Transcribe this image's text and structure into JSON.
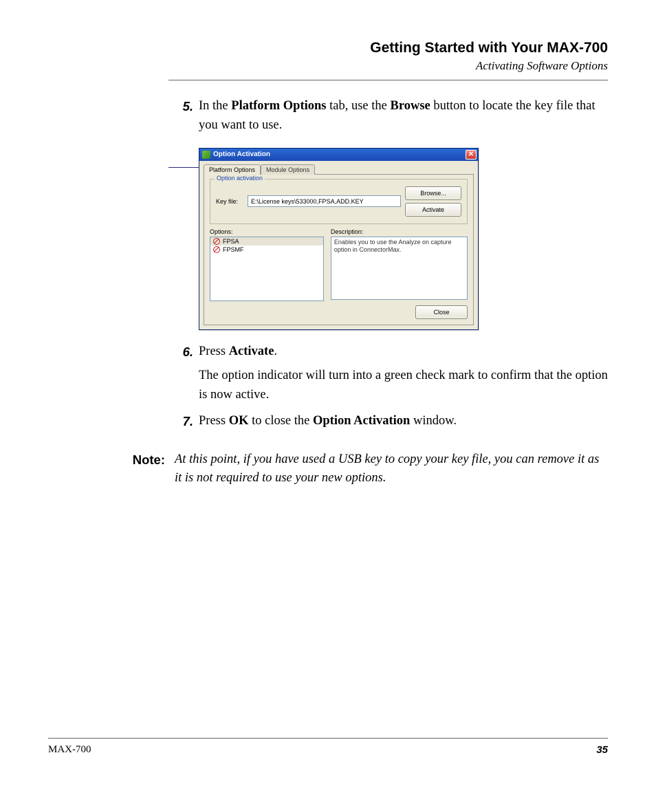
{
  "header": {
    "title": "Getting Started with Your MAX-700",
    "subtitle": "Activating Software Options"
  },
  "steps": {
    "s5": {
      "num": "5.",
      "text_pre": "In the ",
      "b1": "Platform Options",
      "text_mid": " tab, use the ",
      "b2": "Browse",
      "text_post": " button to locate the key file that you want to use."
    },
    "s6": {
      "num": "6.",
      "text_pre": "Press ",
      "b1": "Activate",
      "text_post": ".",
      "para": "The option indicator will turn into a green check mark to confirm that the option is now active."
    },
    "s7": {
      "num": "7.",
      "text_pre": "Press ",
      "b1": "OK",
      "text_mid": " to close the ",
      "b2": "Option Activation",
      "text_post": " window."
    }
  },
  "note": {
    "label": "Note:",
    "text": "At this point, if you have used a USB key to copy your key file, you can remove it as it is not required to use your new options."
  },
  "dialog": {
    "title": "Option Activation",
    "tabs": {
      "t1": "Platform Options",
      "t2": "Module Options"
    },
    "group": "Option activation",
    "keyfile_label": "Key file:",
    "keyfile_value": "E:\\License keys\\533000,FPSA,ADD.KEY",
    "browse": "Browse...",
    "activate": "Activate",
    "options_label": "Options:",
    "description_label": "Description:",
    "options": [
      "FPSA",
      "FPSMF"
    ],
    "description_text": "Enables you to use the Analyze on capture option in ConnectorMax.",
    "close": "Close"
  },
  "footer": {
    "product": "MAX-700",
    "page": "35"
  }
}
